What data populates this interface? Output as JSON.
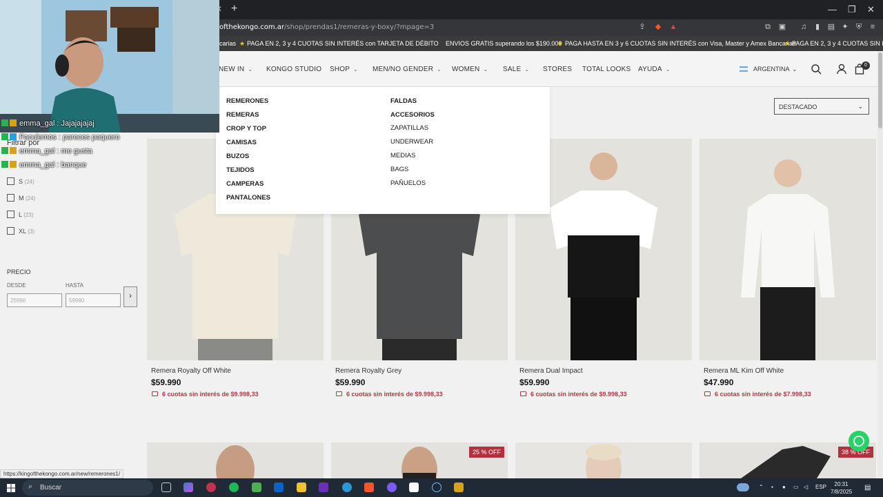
{
  "browser": {
    "url_host": "ofthekongo.com.ar",
    "url_path": "/shop/prendas1/remeras-y-boxy/?mpage=3",
    "status_url": "https://kingofthekongo.com.ar/new/remerones1/"
  },
  "promo_items": [
    "carias",
    "PAGA EN 2, 3 y 4 CUOTAS SIN INTERÉS con TARJETA DE DÉBITO",
    "ENVIOS GRATIS superando los $190.000",
    "PAGA HASTA EN 3 y 6 CUOTAS SIN INTERÉS con Visa, Master y Amex Bancarias",
    "PAGA EN 2, 3 y 4 CUOTAS SIN I"
  ],
  "nav": {
    "items": [
      {
        "label": "NEW IN",
        "dropdown": true
      },
      {
        "label": "KONGO STUDIO",
        "dropdown": false
      },
      {
        "label": "SHOP",
        "dropdown": true
      },
      {
        "label": "MEN/NO GENDER",
        "dropdown": true
      },
      {
        "label": "WOMEN",
        "dropdown": true
      },
      {
        "label": "SALE",
        "dropdown": true
      },
      {
        "label": "STORES",
        "dropdown": false
      },
      {
        "label": "TOTAL LOOKS",
        "dropdown": false
      },
      {
        "label": "AYUDA",
        "dropdown": true
      }
    ],
    "country": "ARGENTINA",
    "cart_count": "0"
  },
  "mega_menu": {
    "col1": [
      "REMERONES",
      "REMERAS",
      "CROP Y TOP",
      "CAMISAS",
      "BUZOS",
      "TEJIDOS",
      "CAMPERAS",
      "PANTALONES"
    ],
    "col2_bold": [
      "FALDAS",
      "ACCESORIOS"
    ],
    "col2": [
      "ZAPATILLAS",
      "UNDERWEAR",
      "MEDIAS",
      "BAGS",
      "PAÑUELOS"
    ]
  },
  "sort": {
    "label": "DESTACADO"
  },
  "sidebar": {
    "filter_title": "Filtrar por",
    "sizes": [
      {
        "label": "S",
        "count": "(24)"
      },
      {
        "label": "M",
        "count": "(24)"
      },
      {
        "label": "L",
        "count": "(23)"
      },
      {
        "label": "XL",
        "count": "(3)"
      }
    ],
    "price_title": "PRECIO",
    "from_label": "DESDE",
    "to_label": "HASTA",
    "from_placeholder": "25990",
    "to_placeholder": "59990"
  },
  "products": [
    {
      "name": "Remera Royalty Off White",
      "price": "$59.990",
      "installments": "6 cuotas sin interés de $9.998,33",
      "color": "#efe9dc"
    },
    {
      "name": "Remera Royalty Grey",
      "price": "$59.990",
      "installments": "6 cuotas sin interés de $9.998,33",
      "color": "#4b4d4e"
    },
    {
      "name": "Remera Dual Impact",
      "price": "$59.990",
      "installments": "6 cuotas sin interés de $9.998,33",
      "color": "#161616"
    },
    {
      "name": "Remera ML Kim Off White",
      "price": "$47.990",
      "installments": "6 cuotas sin interés de $7.998,33",
      "color": "#f4f4f2"
    }
  ],
  "badges": [
    "25 % OFF",
    "38 % OFF"
  ],
  "chat": [
    {
      "user": "emma_gal",
      "msg": "Jajajajajaj"
    },
    {
      "user": "Faculemos",
      "msg": "pareces paquero"
    },
    {
      "user": "emma_gal",
      "msg": "me gusta"
    },
    {
      "user": "emma_gal",
      "msg": "banque"
    }
  ],
  "taskbar": {
    "search": "Buscar",
    "lang": "ESP",
    "time": "20:31",
    "date": "7/8/2025"
  },
  "colors": {
    "accent_red": "#b13a46",
    "promo_bg": "#3b3b3b",
    "taskbar_bg": "#1f2a36"
  }
}
